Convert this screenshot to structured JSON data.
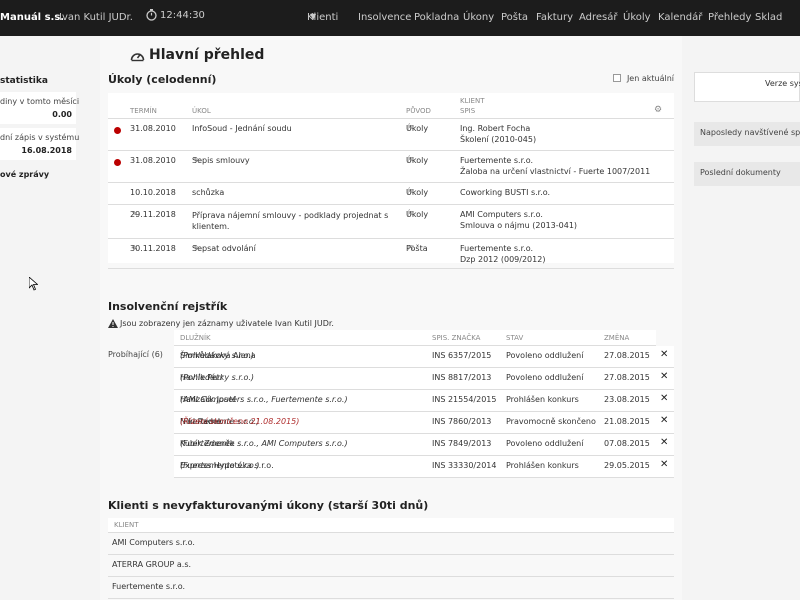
{
  "topbar": {
    "brand": "Manuál s.s.",
    "user": "Ivan Kutil JUDr.",
    "time": "12:44:30",
    "nav": [
      "Klienti",
      "Insolvence",
      "Pokladna",
      "Úkony",
      "Pošta",
      "Faktury",
      "Adresář",
      "Úkoly",
      "Kalendář",
      "Přehledy",
      "Sklad"
    ]
  },
  "left": {
    "header": "statistika",
    "stat1_label": "diny v tomto měsíci",
    "stat1_value": "0.00",
    "stat2_label": "dní zápis v systému",
    "stat2_value": "16.08.2018",
    "messages": "ové zprávy"
  },
  "main": {
    "title": "Hlavní přehled",
    "tasks": {
      "title": "Úkoly (celodenní)",
      "only_current": "Jen aktuální",
      "headers": {
        "term": "TERMÍN",
        "task": "ÚKOL",
        "origin": "PŮVOD",
        "client": "KLIENT",
        "file": "SPIS"
      },
      "rows": [
        {
          "term": "31.08.2010",
          "task": "InfoSoud - Jednání soudu",
          "origin": "Úkoly",
          "client": "Ing. Robert Focha",
          "file": "Školení (2010-045)",
          "overdue": true
        },
        {
          "term": "31.08.2010",
          "task": "Sepis smlouvy",
          "origin": "Úkoly",
          "client": "Fuertemente s.r.o.",
          "file": "Žaloba na určení vlastnictví - Fuerte 1007/2011",
          "overdue": true
        },
        {
          "term": "10.10.2018",
          "task": "schůzka",
          "origin": "Úkoly",
          "client": "Coworking BUSTI s.r.o.",
          "file": "",
          "overdue": false
        },
        {
          "term": "29.11.2018",
          "task": "Příprava nájemní smlouvy - podklady projednat s klientem.",
          "origin": "Úkoly",
          "client": "AMI Computers s.r.o.",
          "file": "Smlouva o nájmu (2013-041)",
          "overdue": false
        },
        {
          "term": "30.11.2018",
          "task": "Sepsat odvolání",
          "origin": "Pošta",
          "client": "Fuertemente s.r.o.",
          "file": "Dzp 2012 (009/2012)",
          "overdue": false
        }
      ]
    },
    "insolvency": {
      "title": "Insolvenční rejstřík",
      "warning": "Jsou zobrazeny jen záznamy uživatele Ivan Kutil JUDr.",
      "side_label": "Probíhající (6)",
      "headers": {
        "debtor": "DLUŽNÍK",
        "file_mark": "SPIS. ZNAČKA",
        "state": "STAV",
        "change": "ZMĚNA"
      },
      "rows": [
        {
          "debtor": "Šimkůlaková Alena",
          "creditor": "(Pohledávky s.r.o.)",
          "extra": "",
          "file_mark": "INS 6357/2015",
          "state": "Povoleno oddlužení",
          "change": "27.08.2015"
        },
        {
          "debtor": "Havlík Petr",
          "creditor": "(Pohledávky s.r.o.)",
          "extra": "",
          "file_mark": "INS 8817/2013",
          "state": "Povoleno oddlužení",
          "change": "27.08.2015"
        },
        {
          "debtor": "Hanzalík Josef",
          "creditor": "(AMI Computers s.r.o., Fuertemente s.r.o.)",
          "extra": "",
          "file_mark": "INS 21554/2015",
          "state": "Prohlášen konkurs",
          "change": "23.08.2015"
        },
        {
          "debtor": "Nikl Radek",
          "creditor": "(Fuertemente s.r.o.)",
          "extra": "(Řízení skončeno 21.08.2015)",
          "file_mark": "INS 7860/2013",
          "state": "Pravomocně skončeno",
          "change": "21.08.2015"
        },
        {
          "debtor": "Kubík Zdeněk",
          "creditor": "(Fuertemente s.r.o., AMI Computers s.r.o.)",
          "extra": "",
          "file_mark": "INS 7849/2013",
          "state": "Povoleno oddlužení",
          "change": "07.08.2015"
        },
        {
          "debtor": "Express Hypotéka s.r.o.",
          "creditor": "(Fuertemente s.r.o.)",
          "extra": "",
          "file_mark": "INS 33330/2014",
          "state": "Prohlášen konkurs",
          "change": "29.05.2015"
        }
      ]
    },
    "clients": {
      "title": "Klienti s nevyfakturovanými úkony (starší 30ti dnů)",
      "header": "KLIENT",
      "rows": [
        "AMI Computers s.r.o.",
        "ATERRA GROUP a.s.",
        "Fuertemente s.r.o."
      ]
    }
  },
  "right": {
    "search": "Verze sys",
    "btn1": "Naposledy navštívené spisy",
    "btn2": "Poslední dokumenty"
  }
}
